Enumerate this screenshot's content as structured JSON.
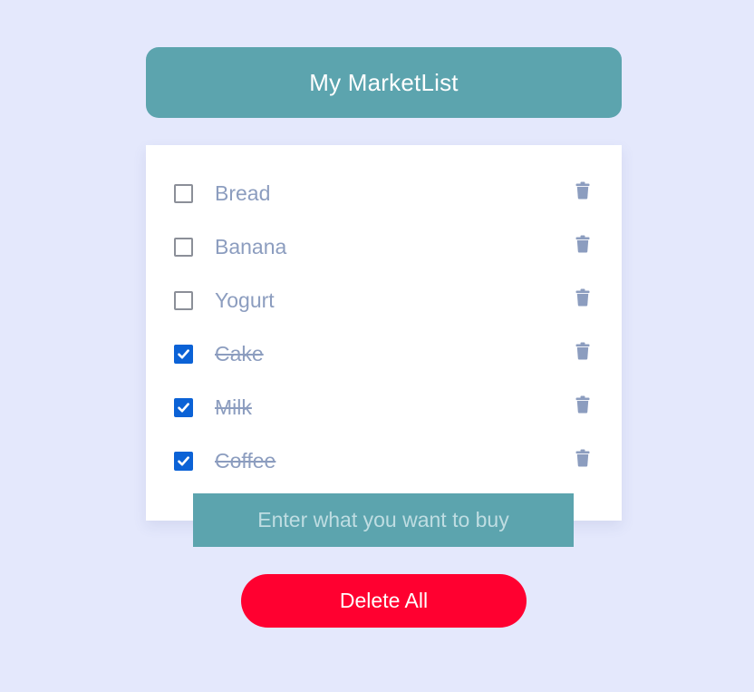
{
  "header": {
    "title": "My MarketList"
  },
  "list": {
    "items": [
      {
        "label": "Bread",
        "checked": false
      },
      {
        "label": "Banana",
        "checked": false
      },
      {
        "label": "Yogurt",
        "checked": false
      },
      {
        "label": "Cake",
        "checked": true
      },
      {
        "label": "Milk",
        "checked": true
      },
      {
        "label": "Coffee",
        "checked": true
      }
    ]
  },
  "input": {
    "value": "",
    "placeholder": "Enter what you want to buy"
  },
  "actions": {
    "delete_all_label": "Delete All"
  },
  "icons": {
    "item_delete": "trash-icon",
    "checkmark": "checkmark-icon"
  },
  "colors": {
    "background": "#e4e8fc",
    "header": "#5ca4ae",
    "input_bg": "#5ca4ae",
    "item_text": "#8c9dbf",
    "checkbox_checked": "#0b62d6",
    "checkbox_border": "#8b8f98",
    "trash_icon": "#8c9dbf",
    "delete_all_button": "#ff0030"
  }
}
